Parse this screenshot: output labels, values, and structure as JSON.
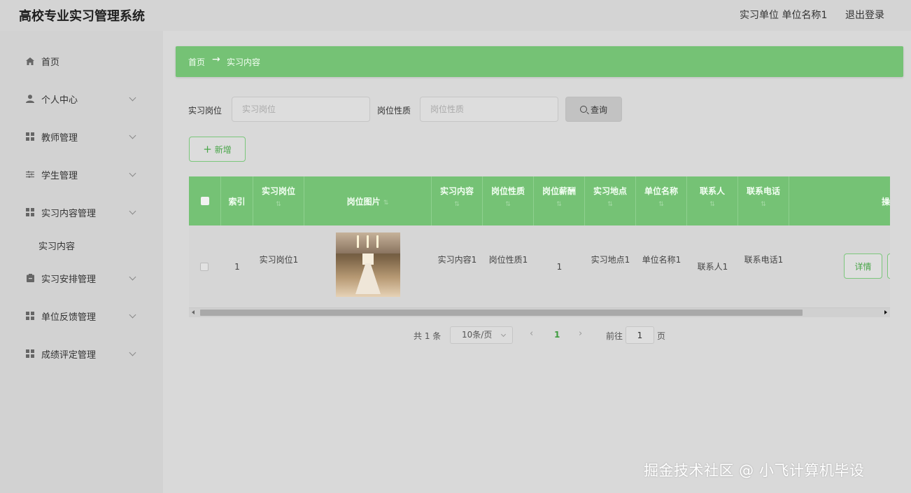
{
  "header": {
    "app_title": "高校专业实习管理系统",
    "user_info": "实习单位 单位名称1",
    "logout": "退出登录"
  },
  "sidebar": {
    "items": [
      {
        "label": "首页",
        "icon": "home-icon"
      },
      {
        "label": "个人中心",
        "icon": "user-icon"
      },
      {
        "label": "教师管理",
        "icon": "grid-icon"
      },
      {
        "label": "学生管理",
        "icon": "sliders-icon"
      },
      {
        "label": "实习内容管理",
        "icon": "grid-icon"
      },
      {
        "label": "实习内容",
        "icon": ""
      },
      {
        "label": "实习安排管理",
        "icon": "clipboard-icon"
      },
      {
        "label": "单位反馈管理",
        "icon": "grid-icon"
      },
      {
        "label": "成绩评定管理",
        "icon": "grid-icon"
      }
    ]
  },
  "breadcrumb": {
    "home": "首页",
    "arrow": "→",
    "current": "实习内容"
  },
  "search": {
    "field1_label": "实习岗位",
    "field1_placeholder": "实习岗位",
    "field2_label": "岗位性质",
    "field2_placeholder": "岗位性质",
    "query_label": "查询"
  },
  "toolbar": {
    "add_label": "新增"
  },
  "table": {
    "columns": [
      "索引",
      "实习岗位",
      "岗位图片",
      "实习内容",
      "岗位性质",
      "岗位薪酬",
      "实习地点",
      "单位名称",
      "联系人",
      "联系电话",
      "操作"
    ],
    "rows": [
      {
        "index": "1",
        "post": "实习岗位1",
        "content": "实习内容1",
        "nature": "岗位性质1",
        "salary": "1",
        "location": "实习地点1",
        "company": "单位名称1",
        "contact": "联系人1",
        "phone": "联系电话1",
        "detail_label": "详情"
      }
    ]
  },
  "pagination": {
    "total": "共 1 条",
    "page_size": "10条/页",
    "current_page": "1",
    "goto_label": "前往",
    "goto_value": "1",
    "page_suffix": "页",
    "prev_icon": "‹",
    "next_icon": "›"
  },
  "watermark": "掘金技术社区 @ 小飞计算机毕设",
  "colors": {
    "accent": "#75c275",
    "accent_text": "#4aa64a",
    "background": "#d4d4d4"
  }
}
